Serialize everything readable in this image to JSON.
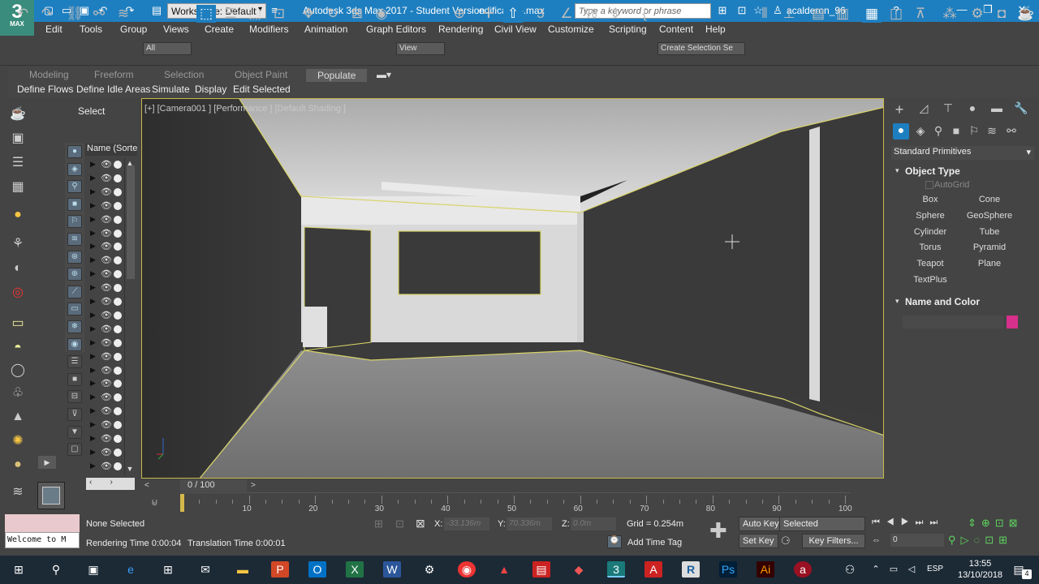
{
  "window": {
    "app_title": "Autodesk 3ds Max 2017 - Student Version",
    "filename": "edificando.max",
    "workspace": "Workspace: Default",
    "search_placeholder": "Type a keyword or phrase",
    "username": "acalderon_96",
    "logo_text": "3",
    "logo_sub": "MAX"
  },
  "menu": [
    "Edit",
    "Tools",
    "Group",
    "Views",
    "Create",
    "Modifiers",
    "Animation",
    "Graph Editors",
    "Rendering",
    "Civil View",
    "Customize",
    "Scripting",
    "Content",
    "Help"
  ],
  "toolbar": {
    "filter": "All",
    "refcoord": "View",
    "selection_set": "Create Selection Se"
  },
  "ribbon": {
    "tabs": [
      "Modeling",
      "Freeform",
      "Selection",
      "Object Paint",
      "Populate"
    ],
    "active_tab": "Populate",
    "buttons": [
      "Define Flows",
      "Define Idle Areas",
      "Simulate",
      "Display",
      "Edit Selected"
    ]
  },
  "explorer": {
    "select_label": "Select",
    "name_header": "Name (Sorted",
    "row_count": 23
  },
  "viewport": {
    "label": "[+] [Camera001 ] [Performance ] [Default Shading ]"
  },
  "command_panel": {
    "category": "Standard Primitives",
    "object_type_header": "Object Type",
    "autogrid": "AutoGrid",
    "buttons": [
      "Box",
      "Cone",
      "Sphere",
      "GeoSphere",
      "Cylinder",
      "Tube",
      "Torus",
      "Pyramid",
      "Teapot",
      "Plane",
      "TextPlus"
    ],
    "name_color_header": "Name and Color",
    "object_color": "#d6308a"
  },
  "timeline": {
    "frame": "0 / 100",
    "ticks": [
      "10",
      "20",
      "30",
      "40",
      "50",
      "60",
      "70",
      "80",
      "90",
      "100"
    ]
  },
  "status": {
    "welcome": "Welcome to M",
    "selection": "None Selected",
    "render_time": "Rendering Time  0:00:04",
    "translation_time": "Translation Time  0:00:01",
    "x_label": "X:",
    "x_value": "-33.136m",
    "y_label": "Y:",
    "y_value": "70.336m",
    "z_label": "Z:",
    "z_value": "0.0m",
    "grid": "Grid = 0.254m",
    "add_time_tag": "Add Time Tag",
    "auto_key": "Auto Key",
    "set_key": "Set Key",
    "key_mode": "Selected",
    "key_filters": "Key Filters...",
    "current_frame": "0"
  },
  "taskbar": {
    "time": "13:55",
    "date": "13/10/2018",
    "lang": "ESP",
    "notifications": "4"
  }
}
